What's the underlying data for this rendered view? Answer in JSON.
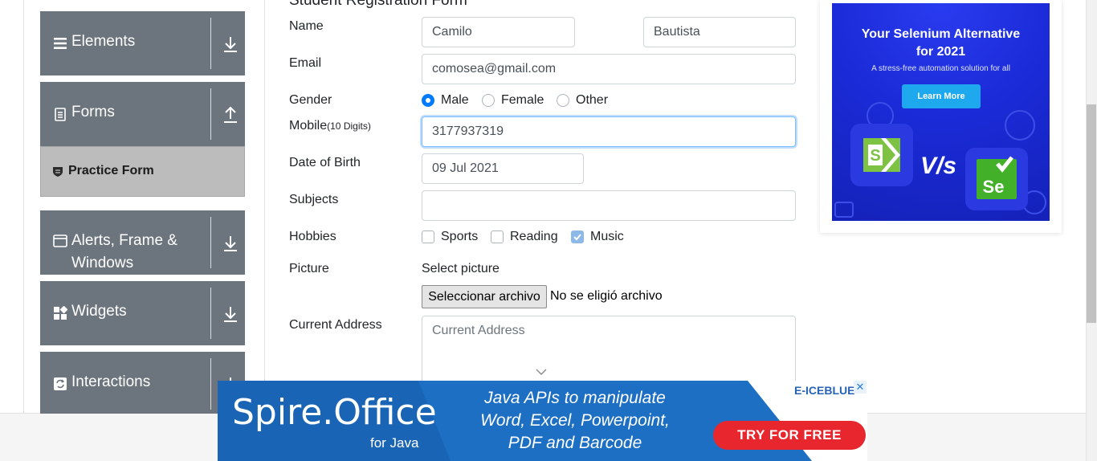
{
  "sidebar": {
    "groups": [
      {
        "label": "Elements",
        "icon": "list-icon",
        "arrow": "download-arrow-icon"
      },
      {
        "label": "Forms",
        "icon": "document-icon",
        "arrow": "upload-arrow-icon"
      },
      {
        "label": "Alerts, Frame &",
        "label2": "Windows",
        "icon": "window-icon",
        "arrow": "download-arrow-icon"
      },
      {
        "label": "Widgets",
        "icon": "grid-icon",
        "arrow": "download-arrow-icon"
      },
      {
        "label": "Interactions",
        "icon": "refresh-icon",
        "arrow": "download-arrow-icon"
      }
    ],
    "active_item": {
      "label": "Practice Form",
      "icon": "shield-icon"
    }
  },
  "form": {
    "title": "Student Registration Form",
    "labels": {
      "name": "Name",
      "email": "Email",
      "gender": "Gender",
      "mobile": "Mobile",
      "mobile_hint": "(10 Digits)",
      "dob": "Date of Birth",
      "subjects": "Subjects",
      "hobbies": "Hobbies",
      "picture": "Picture",
      "address": "Current Address"
    },
    "first_name": "Camilo",
    "last_name": "Bautista",
    "email": "comosea@gmail.com",
    "gender_options": [
      "Male",
      "Female",
      "Other"
    ],
    "gender_selected": "Male",
    "mobile": "3177937319",
    "dob": "09 Jul 2021",
    "subjects": "",
    "hobbies": [
      {
        "label": "Sports",
        "checked": false
      },
      {
        "label": "Reading",
        "checked": false
      },
      {
        "label": "Music",
        "checked": true
      }
    ],
    "picture_label": "Select picture",
    "file_button": "Seleccionar archivo",
    "file_status": "No se eligió archivo",
    "address_placeholder": "Current Address"
  },
  "ad_right": {
    "headline1": "Your Selenium Alternative",
    "headline2": "for 2021",
    "subline": "A stress-free automation solution for all",
    "cta": "Learn More",
    "vs": "V/s",
    "logo_left": "S",
    "logo_right": "Se"
  },
  "ad_bottom": {
    "brand": "Spire.Office",
    "for": "for Java",
    "copy1": "Java APIs to manipulate",
    "copy2": "Word, Excel, Powerpoint,",
    "copy3": "PDF and Barcode",
    "cta": "TRY FOR FREE",
    "vendor": "E-ICEBLUE",
    "close": "✕"
  },
  "colors": {
    "sidebar": "#6c757d",
    "active_item": "#bcbcbc",
    "accent": "#007bff",
    "ad_cta_red": "#e8262d"
  }
}
